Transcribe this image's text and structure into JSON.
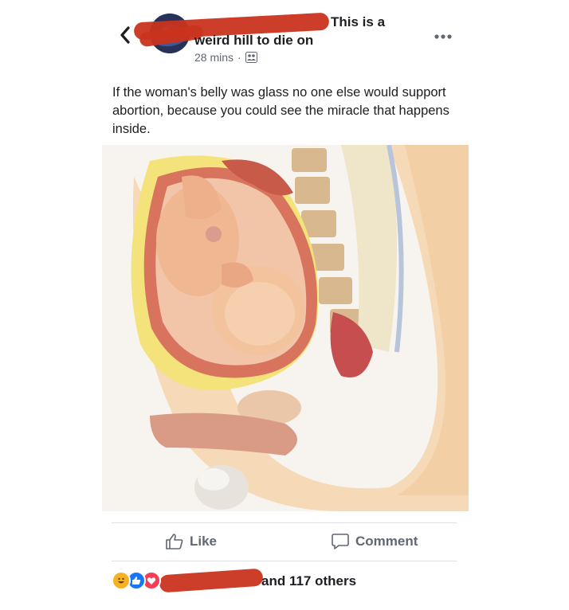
{
  "post": {
    "group_title_tail": "This is a",
    "group_title_line2": "weird hill to die on",
    "time": "28 mins",
    "separator": "·",
    "body": "If the woman's belly was glass no one else would support abortion, because you could see the miracle that happens inside."
  },
  "icons": {
    "back": "chevron-left-icon",
    "more": "more-options-icon",
    "privacy": "group-privacy-icon",
    "like": "thumbs-up-icon",
    "comment": "comment-bubble-icon"
  },
  "actions": {
    "like_label": "Like",
    "comment_label": "Comment"
  },
  "reactions": {
    "types": [
      "haha",
      "like",
      "love"
    ],
    "summary_tail": "and 117 others"
  },
  "colors": {
    "redaction": "#c9341f",
    "like_blue": "#1877f2",
    "love_red": "#f33e58",
    "haha_yellow": "#f7b125"
  }
}
